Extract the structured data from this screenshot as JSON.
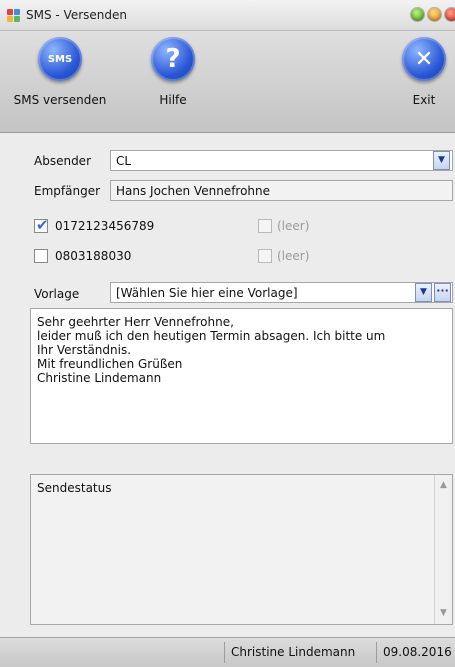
{
  "window": {
    "title": "SMS - Versenden"
  },
  "toolbar": {
    "send": {
      "icon": "sms-icon",
      "icon_text": "SMS",
      "label": "SMS versenden"
    },
    "help": {
      "icon": "help-icon",
      "icon_text": "?",
      "label": "Hilfe"
    },
    "exit": {
      "icon": "close-icon",
      "icon_text": "✕",
      "label": "Exit"
    }
  },
  "form": {
    "sender_label": "Absender",
    "sender_value": "CL",
    "recipient_label": "Empfänger",
    "recipient_value": "Hans Jochen Vennefrohne",
    "numbers": [
      {
        "label": "0172123456789",
        "checked": true
      },
      {
        "label": "(leer)",
        "checked": false,
        "disabled": true
      },
      {
        "label": "0803188030",
        "checked": false
      },
      {
        "label": "(leer)",
        "checked": false,
        "disabled": true
      }
    ],
    "template_label": "Vorlage",
    "template_value": "[Wählen Sie hier eine Vorlage]",
    "template_more": "···"
  },
  "message": {
    "lines": [
      "Sehr geehrter Herr Vennefrohne,",
      "",
      "leider muß ich den heutigen Termin absagen. Ich bitte um",
      "Ihr Verständnis.",
      "",
      "Mit freundlichen Grüßen",
      "Christine Lindemann"
    ]
  },
  "status": {
    "title": "Sendestatus"
  },
  "statusbar": {
    "user": "Christine Lindemann",
    "date": "09.08.2016"
  },
  "colors": {
    "accent": "#2a57d6",
    "check": "#2f6fd6"
  }
}
